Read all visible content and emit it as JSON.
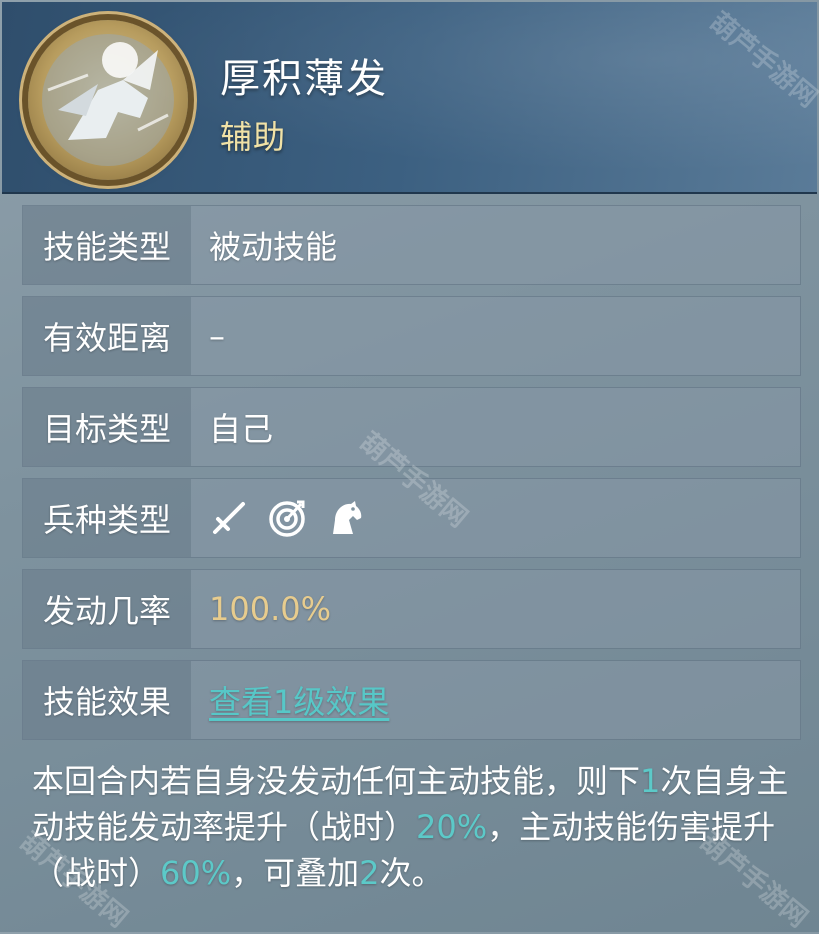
{
  "skill": {
    "name": "厚积薄发",
    "role": "辅助"
  },
  "rows": [
    {
      "label": "技能类型",
      "value": "被动技能"
    },
    {
      "label": "有效距离",
      "value": "–"
    },
    {
      "label": "目标类型",
      "value": "自己"
    },
    {
      "label": "兵种类型",
      "icons": [
        "sword-icon",
        "bow-target-icon",
        "horse-icon"
      ]
    },
    {
      "label": "发动几率",
      "value": "100.0%"
    },
    {
      "label": "技能效果",
      "value": "查看1级效果"
    }
  ],
  "description": {
    "p1": "本回合内若自身没发动任何主动技能，则下",
    "n1": "1",
    "p2": "次自身主动技能发动率提升（战时）",
    "n2": "20%",
    "p3": "，主动技能伤害提升（战时）",
    "n3": "60%",
    "p4": "，可叠加",
    "n4": "2",
    "p5": "次。"
  },
  "watermark": "葫芦手游网",
  "colors": {
    "header_bg": "#3c6081",
    "role_text": "#f1e2a6",
    "rate_text": "#e7cc8e",
    "link_text": "#57c7c7",
    "highlight_number": "#5cc9c8"
  }
}
